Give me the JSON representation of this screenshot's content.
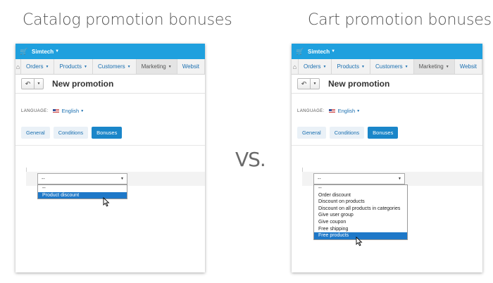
{
  "headings": {
    "left": "Catalog promotion bonuses",
    "right": "Cart promotion bonuses",
    "vs": "VS."
  },
  "panels": [
    {
      "brand": "Simtech",
      "menu": [
        "Orders",
        "Products",
        "Customers",
        "Marketing",
        "Websit"
      ],
      "active_menu": "Marketing",
      "title": "New promotion",
      "language_label": "LANGUAGE:",
      "language_value": "English",
      "tabs": [
        "General",
        "Conditions",
        "Bonuses"
      ],
      "active_tab": "Bonuses",
      "select_value": "--",
      "options": [
        "--",
        "Product discount"
      ],
      "highlighted_option": "Product discount"
    },
    {
      "brand": "Simtech",
      "menu": [
        "Orders",
        "Products",
        "Customers",
        "Marketing",
        "Websit"
      ],
      "active_menu": "Marketing",
      "title": "New promotion",
      "language_label": "LANGUAGE:",
      "language_value": "English",
      "tabs": [
        "General",
        "Conditions",
        "Bonuses"
      ],
      "active_tab": "Bonuses",
      "select_value": "--",
      "options": [
        "--",
        "Order discount",
        "Discount on products",
        "Discount on all products in categories",
        "Give user group",
        "Give coupon",
        "Free shipping",
        "Free products"
      ],
      "highlighted_option": "Free products"
    }
  ],
  "icons": {
    "cart": "cart-icon",
    "home": "home-icon",
    "back": "undo-icon",
    "caret": "caret-down-icon",
    "flag": "us-flag-icon",
    "cursor": "mouse-pointer-icon"
  },
  "colors": {
    "topbar": "#1fa0de",
    "link": "#1a6fb0",
    "active_tab": "#1a86c9",
    "selected_option": "#1e78c8"
  }
}
